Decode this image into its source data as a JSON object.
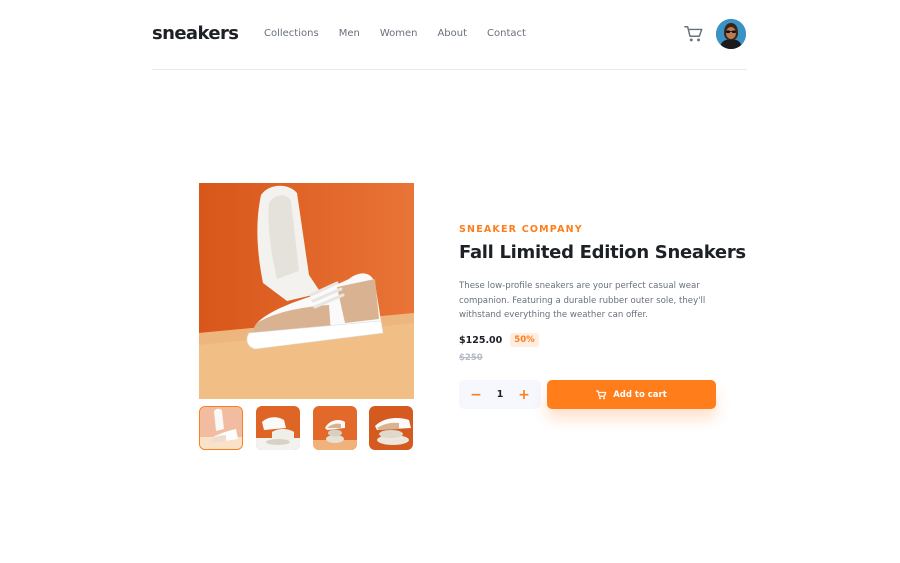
{
  "brand": {
    "logo": "sneakers"
  },
  "nav": {
    "items": [
      "Collections",
      "Men",
      "Women",
      "About",
      "Contact"
    ]
  },
  "header": {
    "cart_icon": "cart-icon",
    "avatar_icon": "user-avatar"
  },
  "product": {
    "company": "SNEAKER COMPANY",
    "title": "Fall Limited Edition Sneakers",
    "description": "These low-profile sneakers are your perfect casual wear companion. Featuring a durable rubber outer sole, they'll withstand everything the weather can offer.",
    "price": "$125.00",
    "discount": "50%",
    "original_price": "$250",
    "quantity": "1",
    "minus_label": "−",
    "plus_label": "+",
    "add_to_cart": "Add to cart"
  },
  "gallery": {
    "selected_thumbnail": 1,
    "thumbnail_count": 4
  },
  "colors": {
    "accent": "#ff7d1a",
    "accent_pale": "#ffede0",
    "text_dark": "#1d2025",
    "text_gray": "#69707d",
    "text_light": "#b6bcc8"
  }
}
